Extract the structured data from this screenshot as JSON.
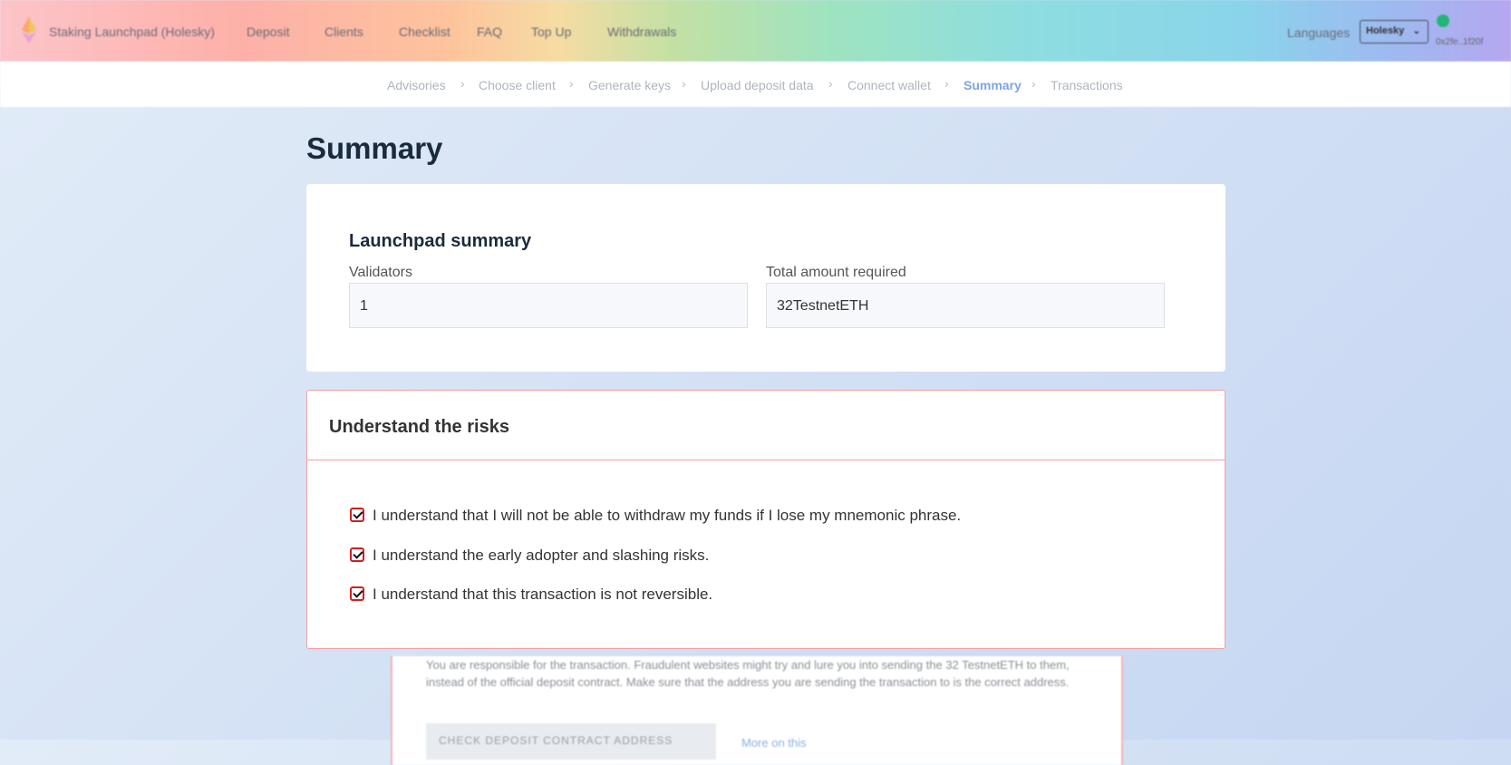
{
  "header": {
    "brand": "Staking Launchpad (Holesky)",
    "nav": [
      "Deposit",
      "Clients",
      "Checklist",
      "FAQ",
      "Top Up",
      "Withdrawals"
    ],
    "languages_label": "Languages",
    "network": "Holesky",
    "wallet_address": "0x2fe..1f20f",
    "status_color": "#22b573"
  },
  "breadcrumb": {
    "steps": [
      "Advisories",
      "Choose client",
      "Generate keys",
      "Upload deposit data",
      "Connect wallet",
      "Summary",
      "Transactions"
    ],
    "active": "Summary"
  },
  "page": {
    "title": "Summary"
  },
  "summary": {
    "title": "Launchpad summary",
    "validators_label": "Validators",
    "validators_value": "1",
    "total_label": "Total amount required",
    "total_value": "32TestnetETH"
  },
  "risks": {
    "title": "Understand the risks",
    "items": [
      {
        "text": "I understand that I will not be able to withdraw my funds if I lose my mnemonic phrase.",
        "checked": true
      },
      {
        "text": "I understand the early adopter and slashing risks.",
        "checked": true
      },
      {
        "text": "I understand that this transaction is not reversible.",
        "checked": true
      }
    ]
  },
  "lower_card": {
    "text": "You are responsible for the transaction. Fraudulent websites might try and lure you into sending the 32 TestnetETH to them, instead of the official deposit contract. Make sure that the address you are sending the transaction to is the correct address.",
    "button_label": "CHECK DEPOSIT CONTRACT ADDRESS",
    "link_label": "More on this"
  },
  "colors": {
    "risk_border": "#f4a0a0",
    "active_crumb": "#7ca5e3",
    "checkbox_border": "#d41e1e"
  }
}
